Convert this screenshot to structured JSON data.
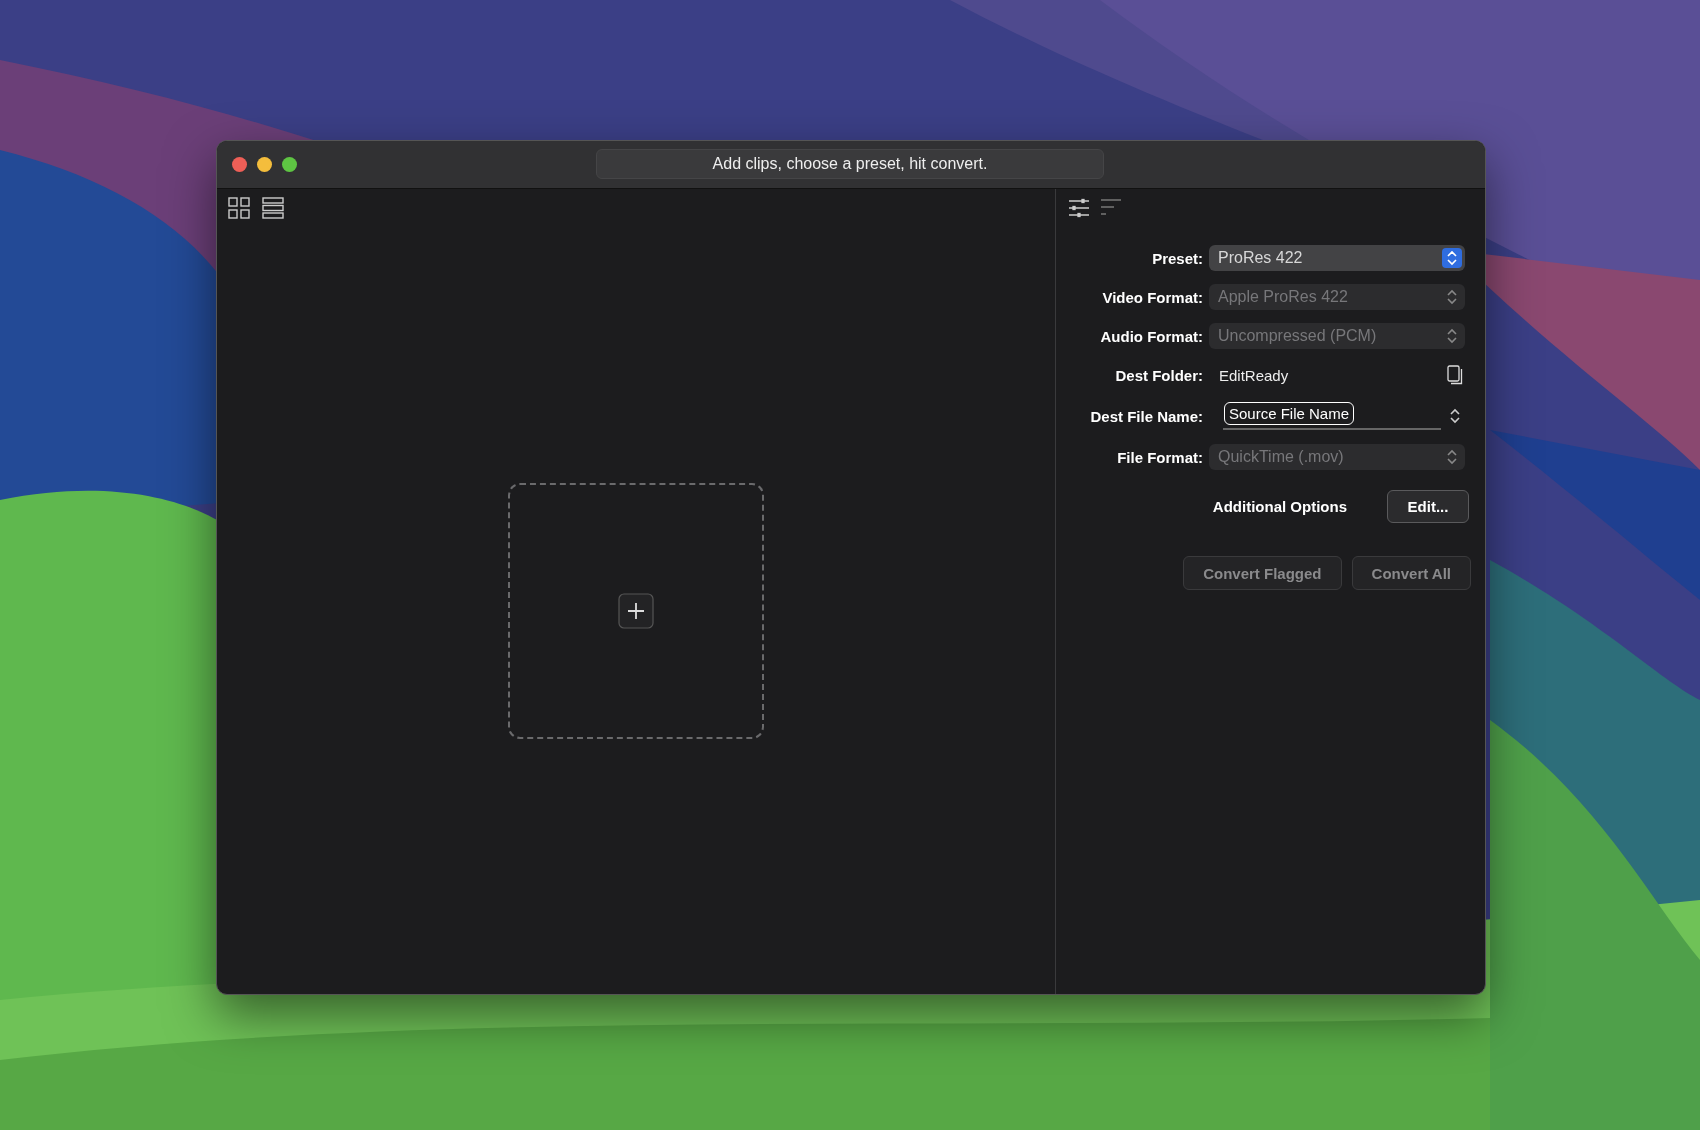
{
  "window": {
    "title": "Add clips, choose a preset, hit convert."
  },
  "settings": [
    {
      "label": "Preset:",
      "kind": "popup",
      "value": "ProRes 422",
      "disabled": false
    },
    {
      "label": "Video Format:",
      "kind": "popup",
      "value": "Apple ProRes 422",
      "disabled": true
    },
    {
      "label": "Audio Format:",
      "kind": "popup",
      "value": "Uncompressed (PCM)",
      "disabled": true
    },
    {
      "label": "Dest Folder:",
      "kind": "folder",
      "value": "EditReady"
    },
    {
      "label": "Dest File Name:",
      "kind": "token",
      "value": "Source File Name"
    },
    {
      "label": "File Format:",
      "kind": "popup",
      "value": "QuickTime (.mov)",
      "disabled": true
    }
  ],
  "additional_options": {
    "label": "Additional Options",
    "button": "Edit..."
  },
  "actions": [
    {
      "label": "Convert Flagged",
      "disabled": true
    },
    {
      "label": "Convert All",
      "disabled": true
    }
  ]
}
